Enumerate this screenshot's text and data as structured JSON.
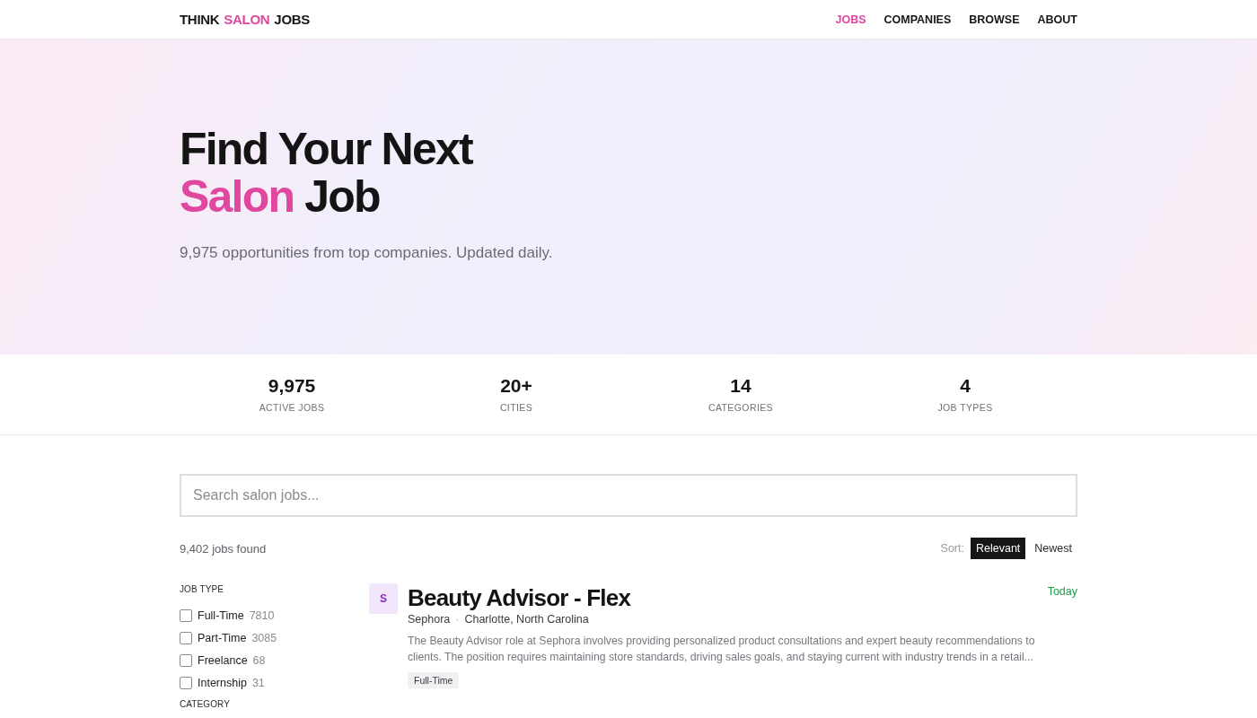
{
  "header": {
    "logo": [
      {
        "text": "THINK",
        "accent": false
      },
      {
        "text": "SALON",
        "accent": true
      },
      {
        "text": "JOBS",
        "accent": false
      }
    ],
    "nav": [
      {
        "label": "JOBS",
        "selected": true
      },
      {
        "label": "COMPANIES",
        "selected": false
      },
      {
        "label": "BROWSE",
        "selected": false
      },
      {
        "label": "ABOUT",
        "selected": false
      }
    ]
  },
  "hero": {
    "title_lines": [
      [
        {
          "text": "Find Your Next",
          "accent": false
        }
      ],
      [
        {
          "text": "Salon",
          "accent": true
        },
        {
          "text": "Job",
          "accent": false
        }
      ]
    ],
    "subtitle": "9,975 opportunities from top companies. Updated daily."
  },
  "stats": [
    {
      "value": "9,975",
      "label": "ACTIVE JOBS"
    },
    {
      "value": "20+",
      "label": "CITIES"
    },
    {
      "value": "14",
      "label": "CATEGORIES"
    },
    {
      "value": "4",
      "label": "JOB TYPES"
    }
  ],
  "search": {
    "placeholder": "Search salon jobs..."
  },
  "results": {
    "count": "9,402 jobs found",
    "sort_label": "Sort:",
    "sort_options": [
      {
        "label": "Relevant",
        "selected": true
      },
      {
        "label": "Newest",
        "selected": false
      }
    ]
  },
  "filters": [
    {
      "title": "JOB TYPE",
      "options": [
        {
          "label": "Full-Time",
          "count": "7810",
          "checked": false
        },
        {
          "label": "Part-Time",
          "count": "3085",
          "checked": false
        },
        {
          "label": "Freelance",
          "count": "68",
          "checked": false
        },
        {
          "label": "Internship",
          "count": "31",
          "checked": false
        }
      ]
    },
    {
      "title": "CATEGORY"
    }
  ],
  "jobs": [
    {
      "logo_letter": "S",
      "title": "Beauty Advisor - Flex",
      "company": "Sephora",
      "separator": "·",
      "location": "Charlotte, North Carolina",
      "description": "The Beauty Advisor role at Sephora involves providing personalized product consultations and expert beauty recommendations to clients. The position requires maintaining store standards, driving sales goals, and staying current with industry trends in a retail...",
      "tags": [
        "Full-Time"
      ],
      "posted": "Today"
    }
  ]
}
